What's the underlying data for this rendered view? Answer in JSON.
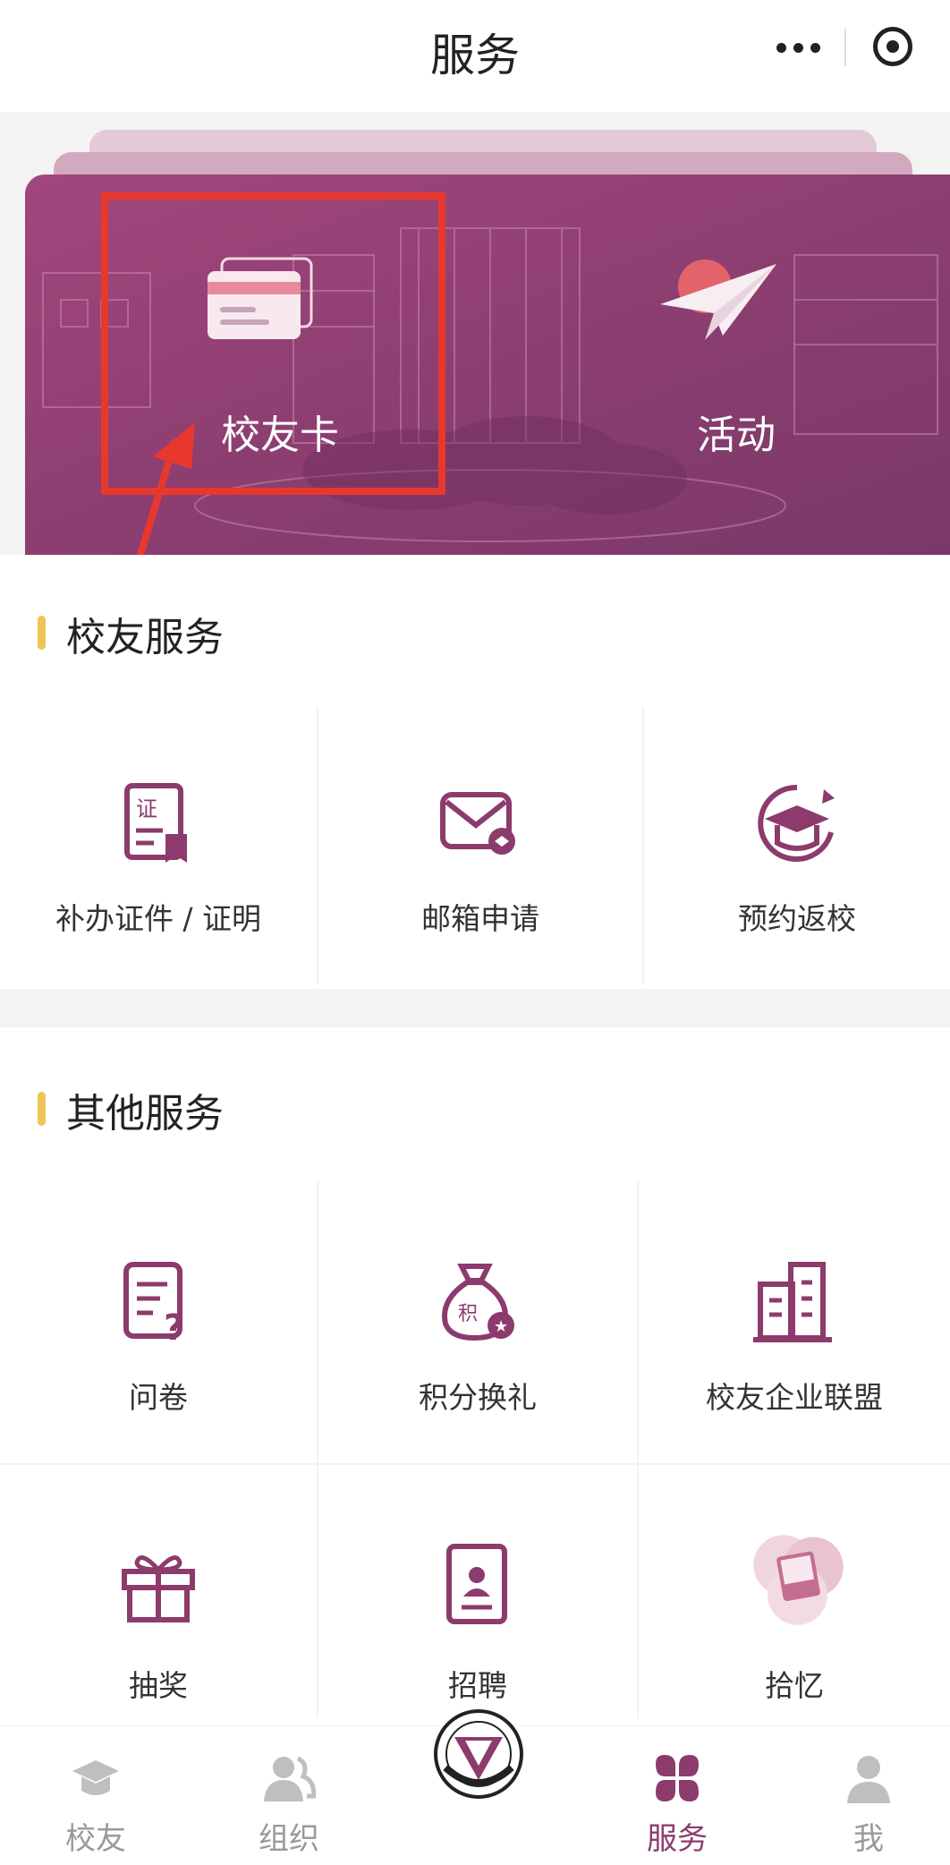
{
  "header": {
    "title": "服务"
  },
  "banner": {
    "items": [
      {
        "label": "校友卡",
        "icon": "card-icon"
      },
      {
        "label": "活动",
        "icon": "paper-plane-icon"
      }
    ]
  },
  "alumni_services": {
    "title": "校友服务",
    "items": [
      {
        "label": "补办证件 / 证明",
        "icon": "certificate-icon"
      },
      {
        "label": "邮箱申请",
        "icon": "mail-icon"
      },
      {
        "label": "预约返校",
        "icon": "graduation-cap-icon"
      }
    ]
  },
  "other_services": {
    "title": "其他服务",
    "items": [
      {
        "label": "问卷",
        "icon": "questionnaire-icon"
      },
      {
        "label": "积分换礼",
        "icon": "points-bag-icon"
      },
      {
        "label": "校友企业联盟",
        "icon": "building-icon"
      },
      {
        "label": "抽奖",
        "icon": "gift-icon"
      },
      {
        "label": "招聘",
        "icon": "resume-icon"
      },
      {
        "label": "拾忆",
        "icon": "memories-icon"
      }
    ]
  },
  "tabbar": {
    "tabs": [
      {
        "label": "校友",
        "icon": "graduation-cap-icon",
        "active": false
      },
      {
        "label": "组织",
        "icon": "people-icon",
        "active": false
      },
      {
        "label": "服务",
        "icon": "clover-icon",
        "active": true
      },
      {
        "label": "我",
        "icon": "person-icon",
        "active": false
      }
    ]
  },
  "colors": {
    "accent": "#8c3b6c",
    "highlight": "#e8382e",
    "section_bar": "#f0c456"
  }
}
